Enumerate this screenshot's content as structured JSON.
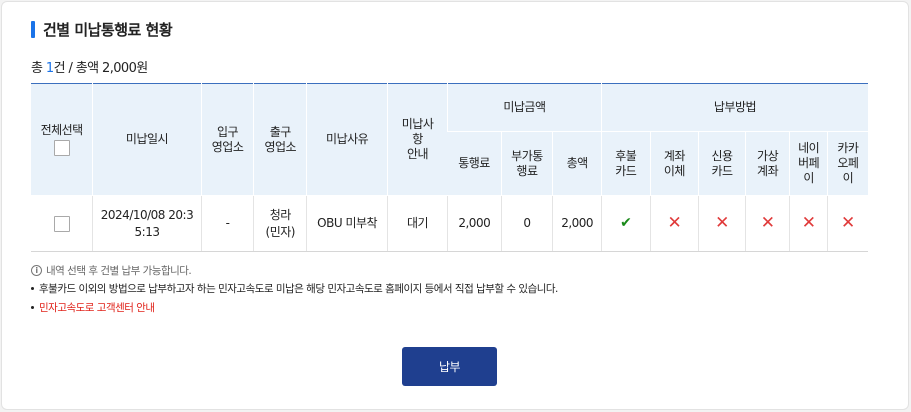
{
  "section": {
    "title": "건별 미납통행료 현황",
    "summary_prefix": "총 ",
    "summary_count": "1",
    "summary_suffix": "건 / 총액 2,000원"
  },
  "table": {
    "headers": {
      "select_all": "전체선택",
      "date": "미납일시",
      "entry": "입구\n영업소",
      "exit": "출구\n영업소",
      "reason": "미납사유",
      "notice": "미납사\n항\n안내",
      "amount_group": "미납금액",
      "toll": "통행료",
      "surcharge": "부가통\n행료",
      "total": "총액",
      "payment_group": "납부방법",
      "deferred_card": "후불\n카드",
      "transfer": "계좌\n이체",
      "credit_card": "신용\n카드",
      "virtual_account": "가상\n계좌",
      "naver_pay": "네이\n버페\n이",
      "kakao_pay": "카카\n오페\n이"
    },
    "rows": [
      {
        "date": "2024/10/08 20:3\n5:13",
        "entry": "-",
        "exit": "청라\n(민자)",
        "reason": "OBU 미부착",
        "notice": "대기",
        "toll": "2,000",
        "surcharge": "0",
        "total": "2,000",
        "methods": {
          "deferred_card": "check-icon",
          "transfer": "x-icon",
          "credit_card": "x-icon",
          "virtual_account": "x-icon",
          "naver_pay": "x-icon",
          "kakao_pay": "x-icon"
        }
      }
    ]
  },
  "notes": {
    "info": "내역 선택 후 건별 납부 가능합니다.",
    "bullet": "후불카드 이외의 방법으로 납부하고자 하는 민자고속도로 미납은 해당 민자고속도로 홈페이지 등에서 직접 납부할 수 있습니다.",
    "link": "민자고속도로 고객센터 안내"
  },
  "pay_button": "납부",
  "colors": {
    "accent": "#1a73e8",
    "header_bg": "#e9f2fa",
    "button_bg": "#1f3f8f",
    "available": "#1a8a1a",
    "unavailable": "#e03a3a",
    "link": "#e0231a"
  }
}
